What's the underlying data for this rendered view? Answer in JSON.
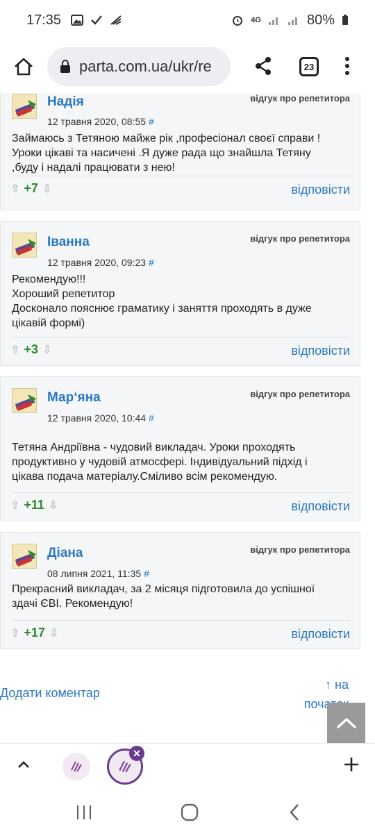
{
  "status": {
    "time": "17:35",
    "network": "4G",
    "battery": "80%"
  },
  "browser": {
    "url": "parta.com.ua/ukr/re",
    "tab_count": "23"
  },
  "reviews": [
    {
      "name": "Надія",
      "tag": "відгук про репетитора",
      "date": "12 травня 2020, 08:55",
      "hash": "#",
      "lines": [
        "Займаюсь з Тетяною майже рік ,професіонал своєї справи !",
        "Уроки цікаві та насичені .Я дуже рада що знайшла Тетяну",
        ",буду і надалі працювати з нею!"
      ],
      "score": "+7",
      "reply": "відповісти"
    },
    {
      "name": "Іванна",
      "tag": "відгук про репетитора",
      "date": "12 травня 2020, 09:23",
      "hash": "#",
      "lines": [
        "Рекомендую!!!",
        "Хороший репетитор",
        "Досконало пояснює граматику і заняття проходять в дуже",
        "цікавій формі)"
      ],
      "score": "+3",
      "reply": "відповісти"
    },
    {
      "name": "Мар‘яна",
      "tag": "відгук про репетитора",
      "date": "12 травня 2020, 10:44",
      "hash": "#",
      "lines": [
        "Тетяна Андріївна - чудовий викладач. Уроки проходять",
        "продуктивно у чудовій атмосфері. Індивідуальний підхід і",
        "цікава подача матеріалу.Сміливо всім рекомендую."
      ],
      "score": "+11",
      "reply": "відповісти"
    },
    {
      "name": "Діана",
      "tag": "відгук про репетитора",
      "date": "08 липня 2021, 11:35",
      "hash": "#",
      "lines": [
        "Прекрасний викладач, за 2 місяця підготовила до успішної",
        "здачі ЄВІ. Рекомендую!"
      ],
      "score": "+17",
      "reply": "відповісти"
    }
  ],
  "footer": {
    "add_comment": "Додати коментар",
    "to_top_line1": "↑ на",
    "to_top_line2": "початок"
  },
  "colors": {
    "link": "#2a78be",
    "score": "#2e8b2e",
    "card_bg": "#f4f6f8",
    "tab_accent": "#6a3c8e"
  },
  "icons": [
    "home-icon",
    "lock-icon",
    "share-icon",
    "more-icon",
    "thumb-up-icon",
    "thumb-down-icon",
    "chevron-up-icon",
    "plus-icon",
    "close-icon",
    "recents-icon",
    "home-nav-icon",
    "back-icon"
  ]
}
